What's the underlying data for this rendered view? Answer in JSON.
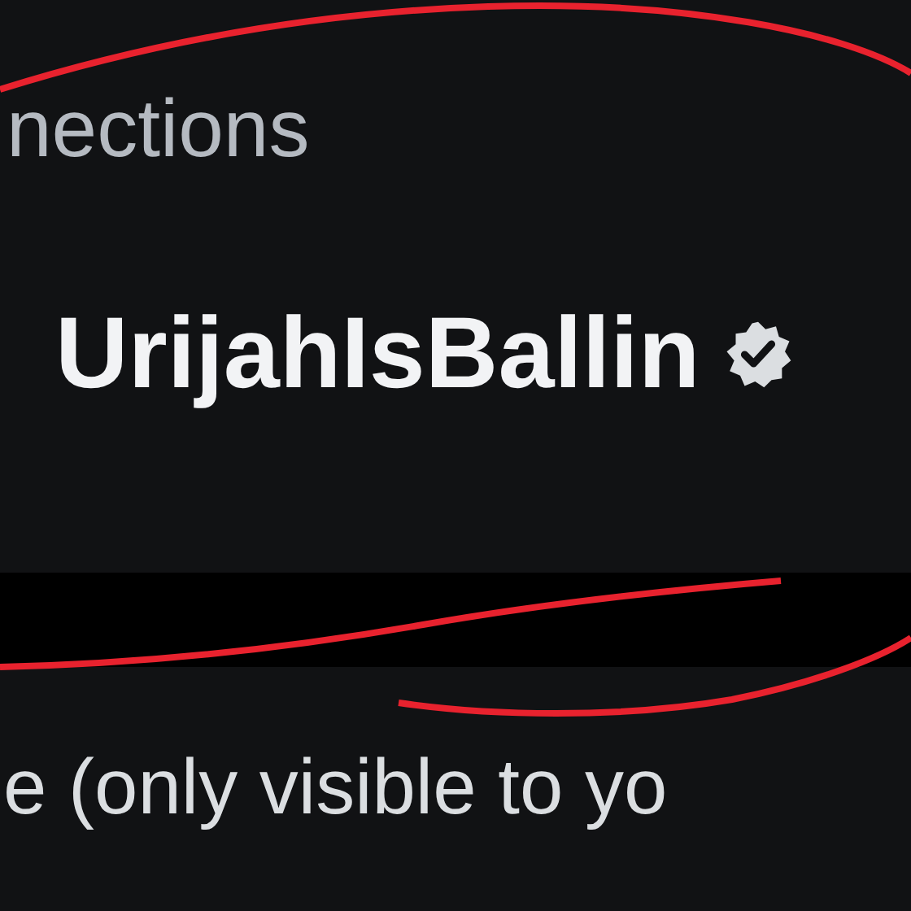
{
  "section_heading": "nections",
  "profile": {
    "username": "UrijahIsBallin",
    "verified": true
  },
  "note": "e (only visible to yo"
}
